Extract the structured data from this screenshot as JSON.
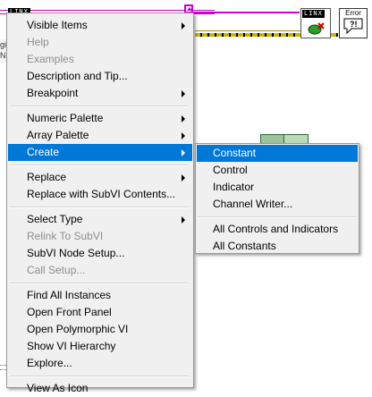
{
  "diagram": {
    "linx_label_left": "LINX",
    "linx_label_right": "LINX",
    "error_label": "Error",
    "left_strip_text": [
      "gi",
      "N"
    ]
  },
  "menu": {
    "items": [
      {
        "label": "Visible Items",
        "submenu": true,
        "disabled": false
      },
      {
        "label": "Help",
        "submenu": false,
        "disabled": true
      },
      {
        "label": "Examples",
        "submenu": false,
        "disabled": true
      },
      {
        "label": "Description and Tip...",
        "submenu": false,
        "disabled": false
      },
      {
        "label": "Breakpoint",
        "submenu": true,
        "disabled": false
      },
      {
        "label": "Numeric Palette",
        "submenu": true,
        "disabled": false
      },
      {
        "label": "Array Palette",
        "submenu": true,
        "disabled": false
      },
      {
        "label": "Create",
        "submenu": true,
        "disabled": false,
        "highlighted": true
      },
      {
        "label": "Replace",
        "submenu": true,
        "disabled": false
      },
      {
        "label": "Replace with SubVI Contents...",
        "submenu": false,
        "disabled": false
      },
      {
        "label": "Select Type",
        "submenu": true,
        "disabled": false
      },
      {
        "label": "Relink To SubVI",
        "submenu": false,
        "disabled": true
      },
      {
        "label": "SubVI Node Setup...",
        "submenu": false,
        "disabled": false
      },
      {
        "label": "Call Setup...",
        "submenu": false,
        "disabled": true
      },
      {
        "label": "Find All Instances",
        "submenu": false,
        "disabled": false
      },
      {
        "label": "Open Front Panel",
        "submenu": false,
        "disabled": false
      },
      {
        "label": "Open Polymorphic VI",
        "submenu": false,
        "disabled": false
      },
      {
        "label": "Show VI Hierarchy",
        "submenu": false,
        "disabled": false
      },
      {
        "label": "Explore...",
        "submenu": false,
        "disabled": false
      },
      {
        "label": "View As Icon",
        "submenu": false,
        "disabled": false
      }
    ]
  },
  "submenu": {
    "items": [
      {
        "label": "Constant",
        "highlighted": true
      },
      {
        "label": "Control"
      },
      {
        "label": "Indicator"
      },
      {
        "label": "Channel Writer..."
      },
      {
        "label": "All Controls and Indicators"
      },
      {
        "label": "All Constants"
      }
    ]
  },
  "colors": {
    "highlight": "#0078d7",
    "menu_bg": "#f0f0f0",
    "wire_pink": "#cc00cc",
    "wire_yellow": "#c8b400"
  }
}
